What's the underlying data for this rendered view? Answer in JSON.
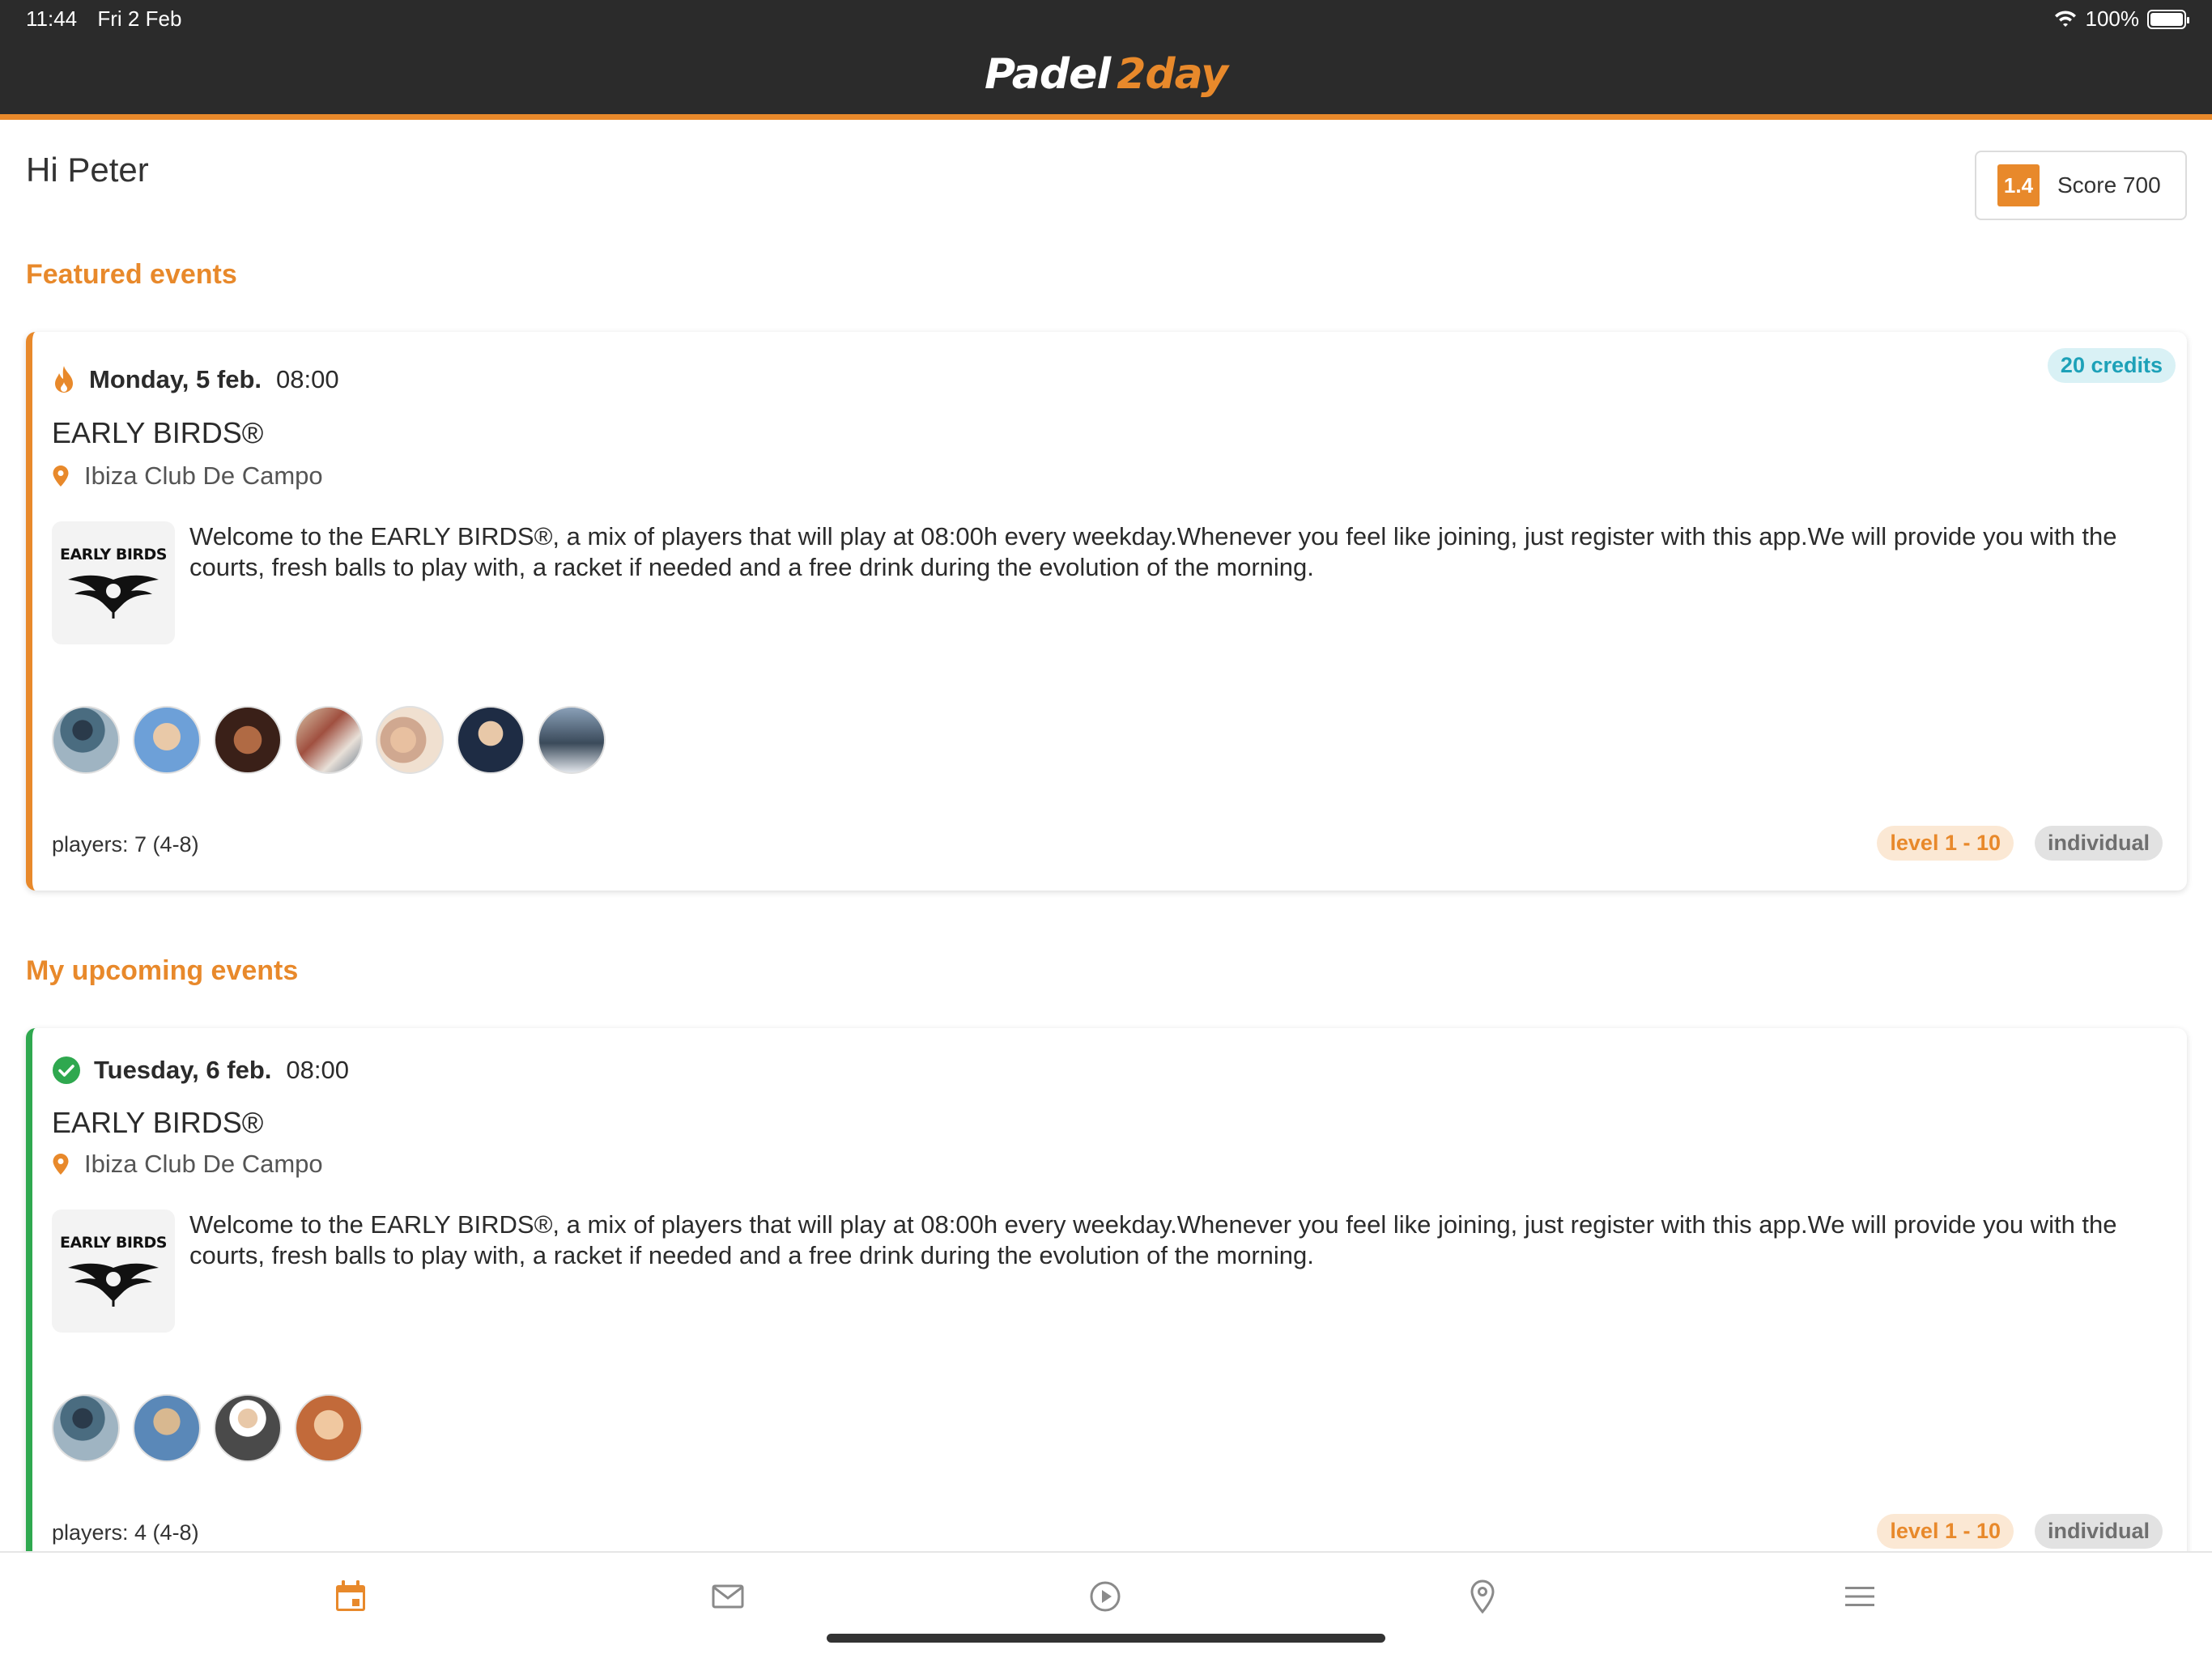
{
  "status_bar": {
    "time": "11:44",
    "date": "Fri 2 Feb",
    "battery": "100%"
  },
  "app": {
    "logo_part1": "Padel",
    "logo_part2": "2day"
  },
  "greeting": "Hi Peter",
  "score": {
    "level": "1.4",
    "label": "Score 700"
  },
  "sections": {
    "featured": "Featured events",
    "upcoming": "My upcoming events"
  },
  "featured_event": {
    "day": "Monday, 5 feb.",
    "time": "08:00",
    "credits": "20 credits",
    "title": "EARLY BIRDS®",
    "location": "Ibiza Club De Campo",
    "thumb_label": "EARLY BIRDS",
    "description": "Welcome to the EARLY BIRDS®, a mix of players that will play at 08:00h every weekday.Whenever you feel like joining, just register with this app.We will provide you with the courts, fresh balls to play with, a racket if needed and a free drink during the evolution of the morning.",
    "players": "players: 7 (4-8)",
    "level": "level 1 - 10",
    "type": "individual",
    "avatar_count": 7
  },
  "upcoming_event": {
    "day": "Tuesday, 6 feb.",
    "time": "08:00",
    "title": "EARLY BIRDS®",
    "location": "Ibiza Club De Campo",
    "thumb_label": "EARLY BIRDS",
    "description": "Welcome to the EARLY BIRDS®, a mix of players that will play at 08:00h every weekday.Whenever you feel like joining, just register with this app.We will provide you with the courts, fresh balls to play with, a racket if needed and a free drink during the evolution of the morning.",
    "players": "players: 4 (4-8)",
    "level": "level 1 - 10",
    "type": "individual",
    "avatar_count": 4
  },
  "nav": {
    "items": [
      {
        "icon": "calendar-icon",
        "active": true
      },
      {
        "icon": "mail-icon",
        "active": false
      },
      {
        "icon": "play-circle-icon",
        "active": false
      },
      {
        "icon": "map-pin-icon",
        "active": false
      },
      {
        "icon": "menu-icon",
        "active": false
      }
    ]
  },
  "colors": {
    "accent": "#e8892b",
    "dark": "#2b2b2b",
    "green": "#2fa84f",
    "teal": "#1da1b8"
  }
}
